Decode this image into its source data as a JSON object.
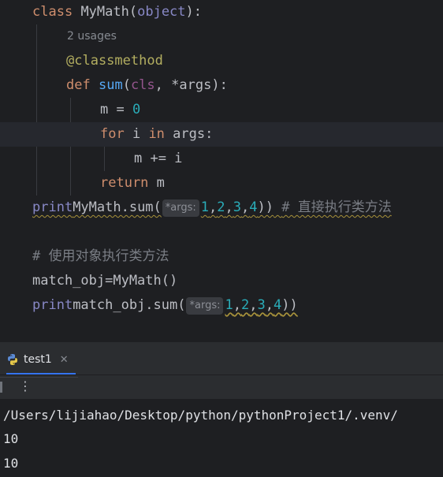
{
  "editor": {
    "lines": {
      "class_kw": "class",
      "class_name": "MyMath",
      "class_base": "object",
      "usages": "2 usages",
      "decorator": "@classmethod",
      "def_kw": "def",
      "func_name": "sum",
      "param_cls": "cls",
      "param_args": "*args",
      "m_assign": "m = ",
      "m_zero": "0",
      "for_kw": "for",
      "for_var": " i ",
      "in_kw": "in",
      "for_iter": " args:",
      "m_add": "m += i",
      "return_kw": "return",
      "return_val": " m",
      "print1_fn": "print",
      "print1_call": "MyMath.sum(",
      "print1_hint": "*args:",
      "print1_nums": [
        "1",
        "2",
        "3",
        "4"
      ],
      "print1_close": "))",
      "print1_comment": "# 直接执行类方法",
      "comment2": "# 使用对象执行类方法",
      "obj_assign": "match_obj=MyMath()",
      "print2_fn": "print",
      "print2_call": "match_obj.sum(",
      "print2_hint": "*args:",
      "print2_nums": [
        "1",
        "2",
        "3",
        "4"
      ],
      "print2_close": "))"
    }
  },
  "run_panel": {
    "tab_label": "test1",
    "output": [
      "/Users/lijiahao/Desktop/python/pythonProject1/.venv/",
      "10",
      "10"
    ]
  },
  "colors": {
    "background": "#1e1f22",
    "keyword": "#cf8e6d",
    "function": "#56a8f5",
    "builtin": "#8888c6",
    "number": "#2aacb8",
    "decorator": "#b3ae60",
    "comment": "#7a7e85",
    "accent": "#3574f0"
  }
}
